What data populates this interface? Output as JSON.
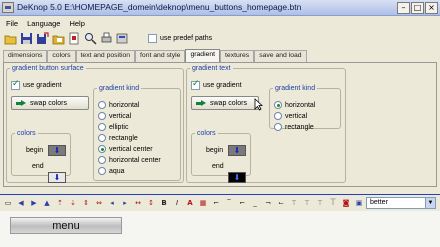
{
  "window": {
    "title": "DeKnop 5.0  E:\\HOMEPAGE_domein\\deknop\\menu_buttons_homepage.btn",
    "min": "–",
    "max": "□",
    "close": "×"
  },
  "menu": [
    "File",
    "Language",
    "Help"
  ],
  "toolbar": {
    "predef_label": "use predef paths"
  },
  "tabs": [
    "dimensions",
    "colors",
    "text and position",
    "font and style",
    "gradient",
    "textures",
    "save and load"
  ],
  "active_tab": "gradient",
  "surface": {
    "legend": "gradient button surface",
    "use_gradient": "use gradient",
    "swap_label": "swap colors",
    "kind_legend": "gradient kind",
    "kinds": [
      "horizontal",
      "vertical",
      "elliptic",
      "rectangle",
      "vertical center",
      "horizontal center",
      "aqua"
    ],
    "selected_kind": "vertical center",
    "colors_legend": "colors",
    "begin_label": "begin",
    "end_label": "end",
    "begin_color": "#7a7a7a",
    "end_color": "#1428b8"
  },
  "text": {
    "legend": "gradient text",
    "use_gradient": "use gradient",
    "swap_label": "swap colors",
    "kind_legend": "gradient kind",
    "kinds": [
      "horizontal",
      "vertical",
      "rectangle"
    ],
    "selected_kind": "horizontal",
    "colors_legend": "colors",
    "begin_label": "begin",
    "end_label": "end",
    "begin_color": "#7a7a7a",
    "end_color": "#000000"
  },
  "font_select": {
    "value": "better"
  },
  "preview": {
    "button_label": "menu"
  }
}
